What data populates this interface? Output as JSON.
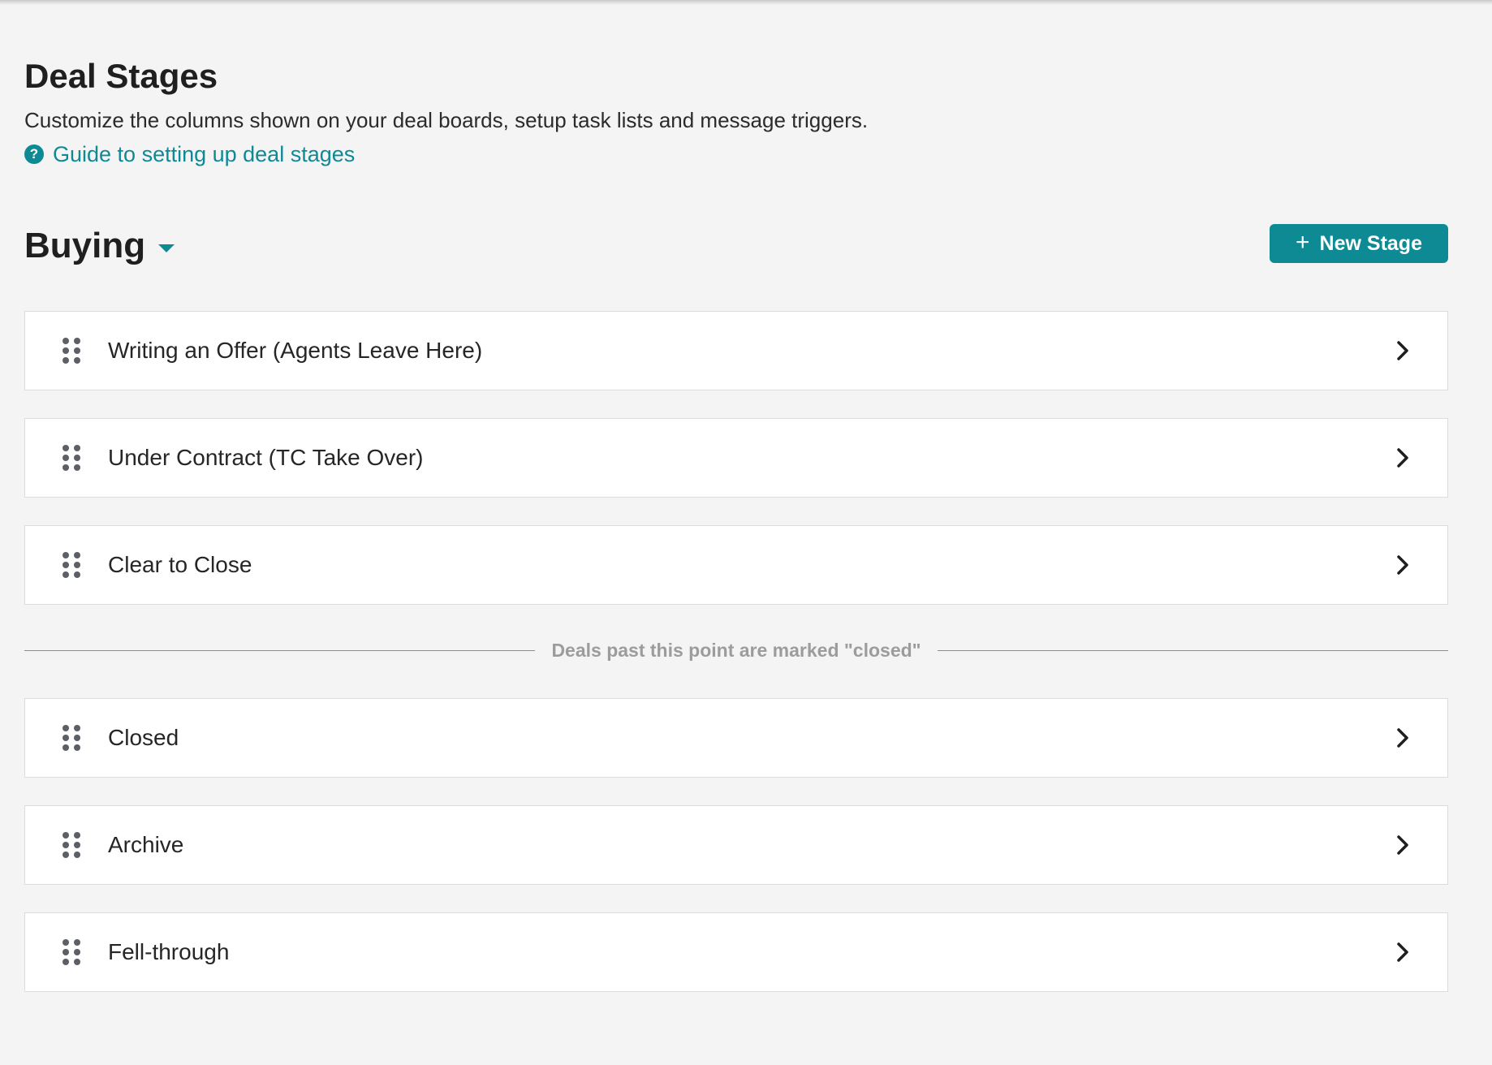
{
  "page": {
    "title": "Deal Stages",
    "description": "Customize the columns shown on your deal boards, setup task lists and message triggers.",
    "guide_link": "Guide to setting up deal stages",
    "guide_icon": "?"
  },
  "section": {
    "title": "Buying"
  },
  "toolbar": {
    "plus": "+",
    "new_stage_label": "New Stage"
  },
  "stages": [
    {
      "label": "Writing an Offer (Agents Leave Here)"
    },
    {
      "label": "Under Contract (TC Take Over)"
    },
    {
      "label": "Clear to Close"
    },
    {
      "label": "Closed"
    },
    {
      "label": "Archive"
    },
    {
      "label": "Fell-through"
    }
  ],
  "divider": {
    "label": "Deals past this point are marked \"closed\""
  },
  "colors": {
    "accent": "#0e8a95",
    "background": "#f4f4f4",
    "row_background": "#ffffff",
    "handle": "#5c5f66",
    "divider_text": "#9c9c9c"
  }
}
